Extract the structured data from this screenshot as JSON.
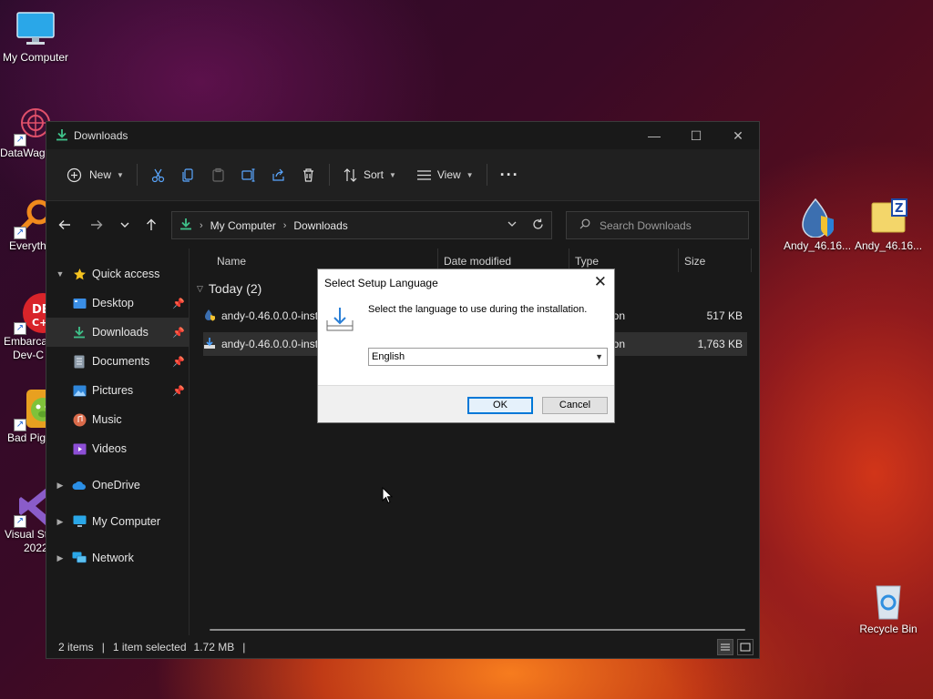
{
  "desktop": {
    "icons": [
      {
        "label": "My Computer"
      },
      {
        "label": "DataWag"
      },
      {
        "label": "Everyth"
      },
      {
        "label": "Embarca",
        "label2": "Dev-C"
      },
      {
        "label": "Bad Pigg"
      },
      {
        "label": "Visual St",
        "label2": "2022"
      },
      {
        "label": "Andy_46.16..."
      },
      {
        "label": "Andy_46.16..."
      },
      {
        "label": "Recycle Bin"
      }
    ]
  },
  "explorer": {
    "title": "Downloads",
    "toolbar": {
      "new_label": "New",
      "sort_label": "Sort",
      "view_label": "View",
      "more_label": "···"
    },
    "address": {
      "crumbs": [
        "My Computer",
        "Downloads"
      ],
      "search_placeholder": "Search Downloads"
    },
    "sidebar": {
      "items": [
        {
          "label": "Quick access"
        },
        {
          "label": "Desktop"
        },
        {
          "label": "Downloads"
        },
        {
          "label": "Documents"
        },
        {
          "label": "Pictures"
        },
        {
          "label": "Music"
        },
        {
          "label": "Videos"
        },
        {
          "label": "OneDrive"
        },
        {
          "label": "My Computer"
        },
        {
          "label": "Network"
        }
      ]
    },
    "columns": [
      "Name",
      "Date modified",
      "Type",
      "Size"
    ],
    "group_label": "Today (2)",
    "files": [
      {
        "name": "andy-0.46.0.0.0-inst",
        "type": "ion",
        "size": "517 KB"
      },
      {
        "name": "andy-0.46.0.0.0-inst",
        "type": "ion",
        "size": "1,763 KB"
      }
    ],
    "status": {
      "items": "2 items",
      "selected": "1 item selected",
      "size": "1.72 MB"
    }
  },
  "dialog": {
    "title": "Select Setup Language",
    "message": "Select the language to use during the installation.",
    "language": "English",
    "ok_label": "OK",
    "cancel_label": "Cancel"
  }
}
